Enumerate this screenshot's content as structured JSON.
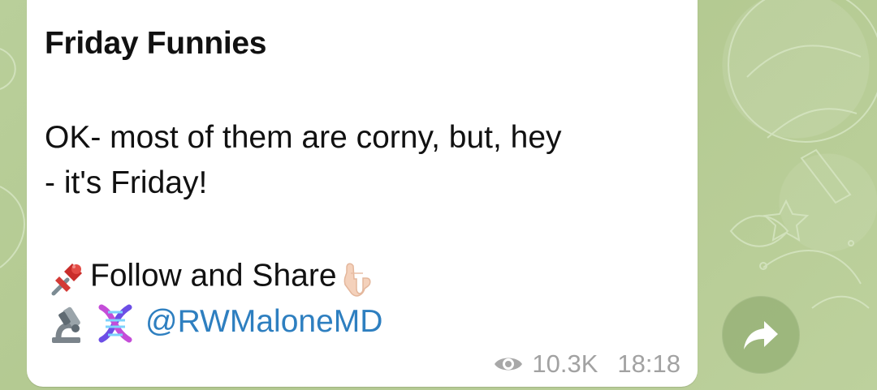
{
  "message": {
    "title": "Friday Funnies",
    "lines": [
      "OK- most of them are corny, but, hey",
      "- it's Friday!"
    ],
    "follow_text": "Follow and Share",
    "handle": "@RWMaloneMD",
    "views": "10.3K",
    "time": "18:18"
  },
  "icons": {
    "pin": "pushpin-icon",
    "pointing": "pointing-down-icon",
    "microscope": "microscope-icon",
    "dna": "dna-icon",
    "views": "eye-icon",
    "share": "forward-icon"
  },
  "colors": {
    "wallpaper": "#b7cc98",
    "bubble": "#ffffff",
    "text": "#111111",
    "link": "#2e7fc0",
    "meta": "#a2a2a2",
    "share_button": "#95af75"
  }
}
